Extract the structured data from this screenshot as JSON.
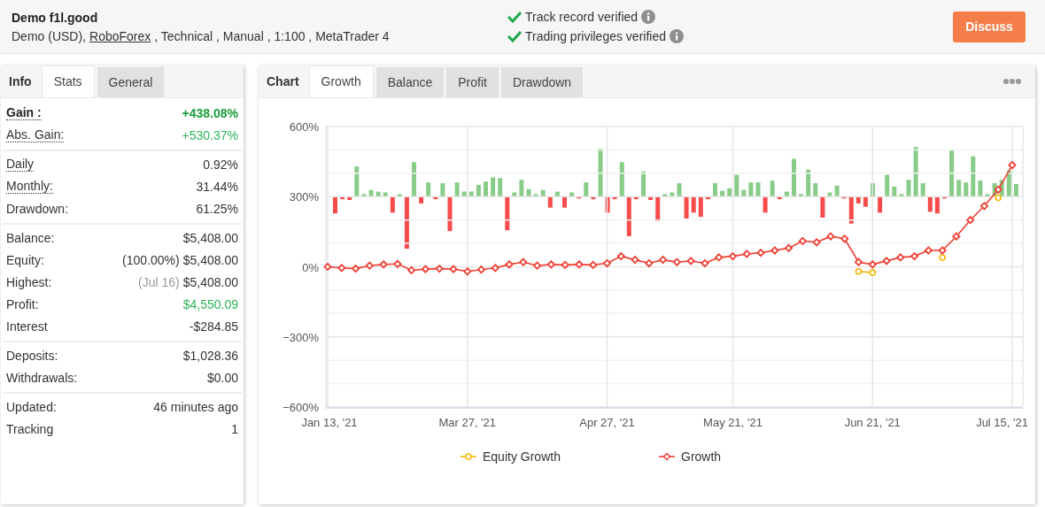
{
  "header": {
    "title": "Demo f1l.good",
    "details": [
      {
        "text": "Demo (USD),",
        "link": false
      },
      {
        "text": "RoboForex",
        "link": true
      },
      {
        "text": ", Technical , Manual , 1:100 , MetaTrader 4",
        "link": false
      }
    ],
    "verifications": [
      {
        "label": "Track record verified",
        "verified": true
      },
      {
        "label": "Trading privileges verified",
        "verified": true
      }
    ],
    "action": "Discuss"
  },
  "stats_panel": {
    "heading": "Info",
    "tabs": [
      {
        "label": "Stats",
        "selected": true
      },
      {
        "label": "General",
        "selected": false
      }
    ],
    "groups": [
      [
        {
          "label": "Gain :",
          "value": "+438.08%",
          "positive": true,
          "bold": true,
          "dotted": true
        },
        {
          "label": "Abs. Gain:",
          "value": "+530.37%",
          "positive": true,
          "bold": false,
          "dotted": true
        }
      ],
      [
        {
          "label": "Daily",
          "value": "0.92%",
          "positive": false,
          "bold": false,
          "dotted": true
        },
        {
          "label": "Monthly:",
          "value": "31.44%",
          "positive": false,
          "bold": false,
          "dotted": true
        },
        {
          "label": "Drawdown:",
          "value": "61.25%",
          "positive": false,
          "bold": false,
          "dotted": false
        }
      ],
      [
        {
          "label": "Balance:",
          "value": "$5,408.00",
          "positive": false,
          "bold": false,
          "dotted": false
        },
        {
          "label": "Equity:",
          "note": "(100.00%)",
          "note_muted": false,
          "value": "$5,408.00",
          "positive": false,
          "bold": false,
          "dotted": false
        },
        {
          "label": "Highest:",
          "note": "(Jul 16)",
          "note_muted": true,
          "value": "$5,408.00",
          "positive": false,
          "bold": false,
          "dotted": false
        },
        {
          "label": "Profit:",
          "value": "$4,550.09",
          "positive": true,
          "bold": false,
          "dotted": false
        },
        {
          "label": "Interest",
          "value": "-$284.85",
          "positive": false,
          "bold": false,
          "dotted": false
        }
      ],
      [
        {
          "label": "Deposits:",
          "value": "$1,028.36",
          "positive": false,
          "bold": false,
          "dotted": false
        },
        {
          "label": "Withdrawals:",
          "value": "$0.00",
          "positive": false,
          "bold": false,
          "dotted": false
        }
      ],
      [
        {
          "label": "Updated:",
          "value": "46 minutes ago",
          "positive": false,
          "bold": false,
          "dotted": false
        },
        {
          "label": "Tracking",
          "value": "1",
          "positive": false,
          "bold": false,
          "dotted": false
        }
      ]
    ]
  },
  "chart_panel": {
    "heading": "Chart",
    "tabs": [
      {
        "label": "Growth",
        "selected": true
      },
      {
        "label": "Balance",
        "selected": false
      },
      {
        "label": "Profit",
        "selected": false
      },
      {
        "label": "Drawdown",
        "selected": false
      }
    ],
    "chart_data": {
      "type": "line",
      "categories": [
        "Jan 13, '21",
        null,
        null,
        null,
        null,
        null,
        null,
        null,
        null,
        null,
        "Mar 27, '21",
        null,
        null,
        null,
        null,
        null,
        null,
        null,
        null,
        null,
        "Apr 27, '21",
        null,
        null,
        null,
        null,
        null,
        null,
        null,
        null,
        "May 21, '21",
        null,
        null,
        null,
        null,
        null,
        null,
        null,
        null,
        null,
        "Jun 21, '21",
        null,
        null,
        null,
        null,
        null,
        null,
        null,
        null,
        null,
        "Jul 15, '21"
      ],
      "series": [
        {
          "name": "Equity Growth",
          "color": "#f7b500",
          "marker": "circle",
          "values": [
            null,
            null,
            null,
            null,
            null,
            null,
            null,
            null,
            null,
            null,
            null,
            null,
            null,
            null,
            null,
            null,
            null,
            null,
            null,
            null,
            null,
            null,
            null,
            null,
            null,
            null,
            null,
            null,
            null,
            null,
            null,
            null,
            null,
            null,
            null,
            null,
            null,
            null,
            -20,
            -25,
            null,
            null,
            null,
            null,
            40,
            null,
            null,
            null,
            295,
            null
          ]
        },
        {
          "name": "Growth",
          "color": "#ef3f33",
          "marker": "diamond",
          "values": [
            0,
            -5,
            -8,
            5,
            10,
            12,
            -15,
            -10,
            -8,
            -10,
            -20,
            -12,
            -5,
            10,
            20,
            5,
            10,
            8,
            10,
            8,
            15,
            45,
            30,
            15,
            30,
            20,
            25,
            15,
            40,
            45,
            55,
            60,
            70,
            80,
            110,
            105,
            130,
            120,
            20,
            10,
            25,
            40,
            45,
            70,
            70,
            130,
            200,
            260,
            330,
            435
          ]
        }
      ],
      "grid": true,
      "legend": true,
      "ylim": [
        -600,
        600
      ],
      "yticks": [
        {
          "value": 600,
          "label": "600%"
        },
        {
          "value": 300,
          "label": "300%"
        },
        {
          "value": 0,
          "label": "0%"
        },
        {
          "value": -300,
          "label": "−300%"
        },
        {
          "value": -600,
          "label": "−600%"
        }
      ]
    }
  }
}
